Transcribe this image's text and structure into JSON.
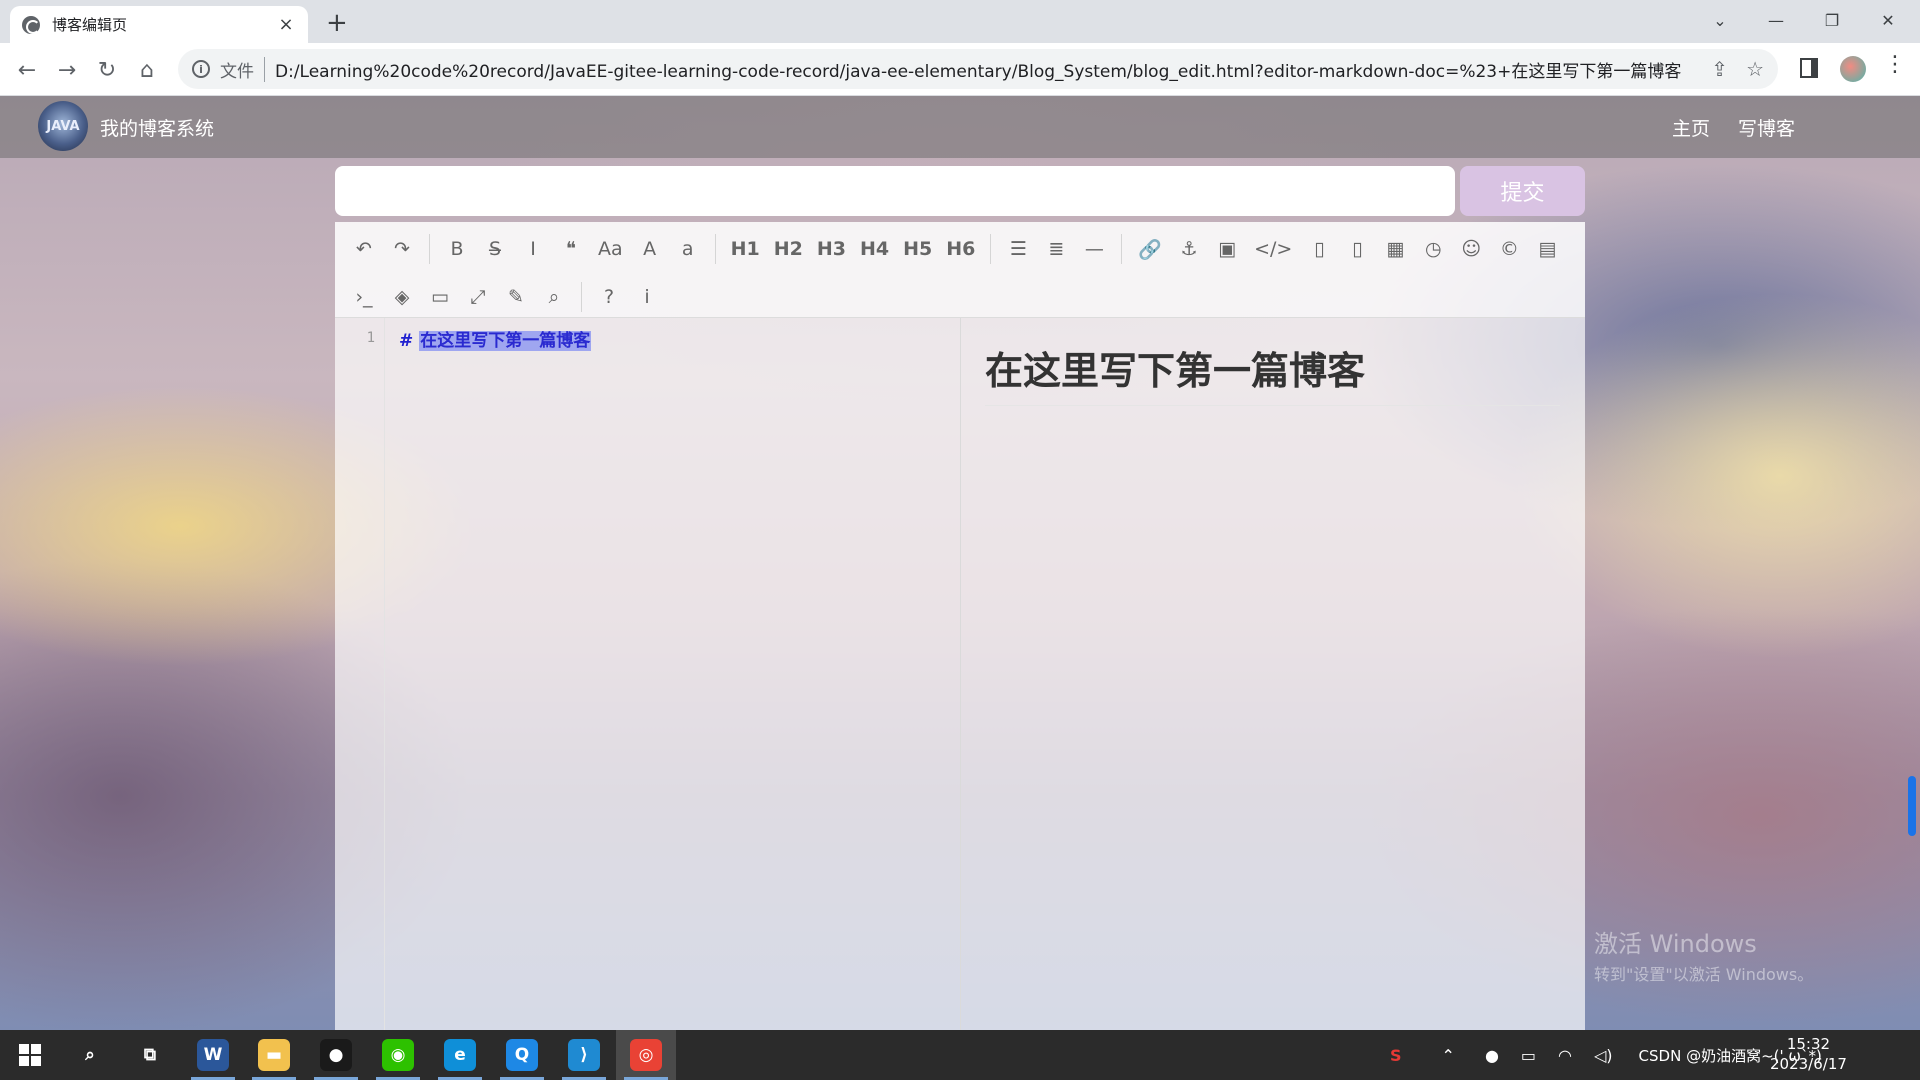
{
  "browser": {
    "tab_title": "博客编辑页",
    "tab_close": "×",
    "new_tab": "+",
    "file_label": "文件",
    "url": "D:/Learning%20code%20record/JavaEE-gitee-learning-code-record/java-ee-elementary/Blog_System/blog_edit.html?editor-markdown-doc=%23+在这里写下第一篇博客",
    "back": "←",
    "forward": "→",
    "reload": "↻",
    "home": "⌂",
    "info": "i",
    "share": "⇪",
    "star": "☆",
    "menu": "⋮",
    "minimize": "—",
    "maximize": "❐",
    "close": "✕",
    "tab_list": "⌄"
  },
  "nav": {
    "logo_text": "JAVA",
    "site_title": "我的博客系统",
    "links": [
      "主页",
      "写博客"
    ]
  },
  "form": {
    "title_value": "",
    "title_placeholder": "",
    "submit_label": "提交"
  },
  "toolbar": {
    "row1": [
      {
        "name": "undo-icon",
        "glyph": "↶"
      },
      {
        "name": "redo-icon",
        "glyph": "↷"
      },
      {
        "sep": true
      },
      {
        "name": "bold-icon",
        "glyph": "B"
      },
      {
        "name": "strikethrough-icon",
        "glyph": "S̶"
      },
      {
        "name": "italic-icon",
        "glyph": "I"
      },
      {
        "name": "quote-icon",
        "glyph": "❝"
      },
      {
        "name": "uppercase-icon",
        "glyph": "Aa"
      },
      {
        "name": "ucwords-icon",
        "glyph": "A"
      },
      {
        "name": "lowercase-icon",
        "glyph": "a"
      },
      {
        "sep": true
      },
      {
        "name": "h1-icon",
        "glyph": "H1",
        "h": true
      },
      {
        "name": "h2-icon",
        "glyph": "H2",
        "h": true
      },
      {
        "name": "h3-icon",
        "glyph": "H3",
        "h": true
      },
      {
        "name": "h4-icon",
        "glyph": "H4",
        "h": true
      },
      {
        "name": "h5-icon",
        "glyph": "H5",
        "h": true
      },
      {
        "name": "h6-icon",
        "glyph": "H6",
        "h": true
      },
      {
        "sep": true
      },
      {
        "name": "unordered-list-icon",
        "glyph": "☰"
      },
      {
        "name": "ordered-list-icon",
        "glyph": "≣"
      },
      {
        "name": "horizontal-rule-icon",
        "glyph": "—"
      },
      {
        "sep": true
      },
      {
        "name": "link-icon",
        "glyph": "🔗"
      },
      {
        "name": "anchor-icon",
        "glyph": "⚓"
      },
      {
        "name": "image-icon",
        "glyph": "▣"
      },
      {
        "name": "code-icon",
        "glyph": "</>"
      },
      {
        "name": "preformatted-code-icon",
        "glyph": "▯"
      },
      {
        "name": "code-block-icon",
        "glyph": "▯"
      },
      {
        "name": "table-icon",
        "glyph": "▦"
      },
      {
        "name": "datetime-icon",
        "glyph": "◷"
      },
      {
        "name": "emoji-icon",
        "glyph": "☺"
      },
      {
        "name": "html-entities-icon",
        "glyph": "©"
      },
      {
        "name": "pagebreak-icon",
        "glyph": "▤"
      }
    ],
    "row2": [
      {
        "name": "goto-line-icon",
        "glyph": "›_"
      },
      {
        "name": "toggle-preview-icon",
        "glyph": "◈"
      },
      {
        "name": "watch-icon",
        "glyph": "▭"
      },
      {
        "name": "fullscreen-icon",
        "glyph": "⤢"
      },
      {
        "name": "clear-icon",
        "glyph": "✎"
      },
      {
        "name": "search-icon",
        "glyph": "⌕"
      },
      {
        "sep": true
      },
      {
        "name": "help-icon",
        "glyph": "?"
      },
      {
        "name": "info-icon",
        "glyph": "i"
      }
    ]
  },
  "editor": {
    "line_number": "1",
    "hash": "#",
    "selected_text": "在这里写下第一篇博客"
  },
  "preview": {
    "heading": "在这里写下第一篇博客"
  },
  "watermark": {
    "line1": "激活 Windows",
    "line2": "转到\"设置\"以激活 Windows。"
  },
  "taskbar": {
    "apps": [
      {
        "name": "start-button",
        "label": ""
      },
      {
        "name": "search-icon",
        "label": "⌕"
      },
      {
        "name": "task-view-icon",
        "label": "⧉"
      },
      {
        "name": "word-icon",
        "label": "W",
        "color": "#2b579a"
      },
      {
        "name": "file-explorer-icon",
        "label": "▬",
        "color": "#f2c14e"
      },
      {
        "name": "qq-icon",
        "label": "●",
        "color": "#1a1a1a"
      },
      {
        "name": "wechat-icon",
        "label": "◉",
        "color": "#2dc100"
      },
      {
        "name": "edge-icon",
        "label": "e",
        "color": "#0f8fd8"
      },
      {
        "name": "qq-browser-icon",
        "label": "Q",
        "color": "#1e88e5"
      },
      {
        "name": "vscode-icon",
        "label": "⟩",
        "color": "#1f8ad2"
      },
      {
        "name": "chrome-icon",
        "label": "◎",
        "color": "#e94235"
      }
    ],
    "tray_text": "CSDN @奶油酒窝~(' ω`*)",
    "time": "15:32",
    "date": "2023/6/17"
  },
  "colors": {
    "submit_button": "#d9c3e3",
    "selection": "#9fa6f0",
    "navbar": "rgba(110,110,110,0.55)"
  }
}
